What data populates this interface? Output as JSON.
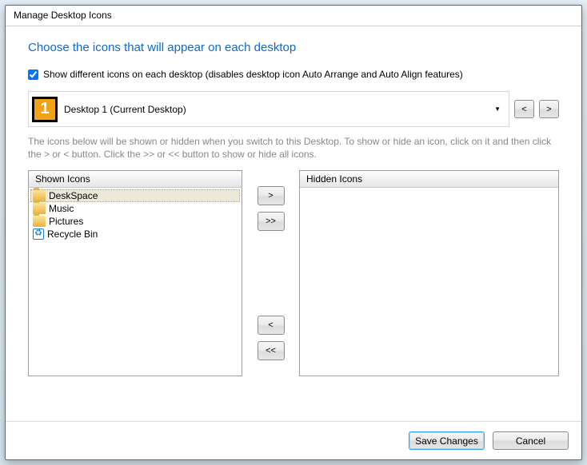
{
  "window": {
    "title": "Manage Desktop Icons"
  },
  "heading": "Choose the icons that will appear on each desktop",
  "checkbox": {
    "label": "Show different icons on each desktop (disables desktop icon Auto Arrange and Auto Align features)"
  },
  "dropdown": {
    "number": "1",
    "label": "Desktop 1 (Current Desktop)"
  },
  "nav": {
    "prev": "<",
    "next": ">"
  },
  "help": "The icons below will be shown or hidden when you switch to this Desktop. To show or hide an icon, click on it and then click the > or < button. Click the >> or << button to show or hide all icons.",
  "shown": {
    "header": "Shown Icons",
    "items": [
      {
        "label": "DeskSpace"
      },
      {
        "label": "Music"
      },
      {
        "label": "Pictures"
      },
      {
        "label": "Recycle Bin"
      }
    ]
  },
  "hidden": {
    "header": "Hidden Icons"
  },
  "transfer": {
    "hide_one": ">",
    "hide_all": ">>",
    "show_one": "<",
    "show_all": "<<"
  },
  "footer": {
    "save": "Save Changes",
    "cancel": "Cancel"
  }
}
